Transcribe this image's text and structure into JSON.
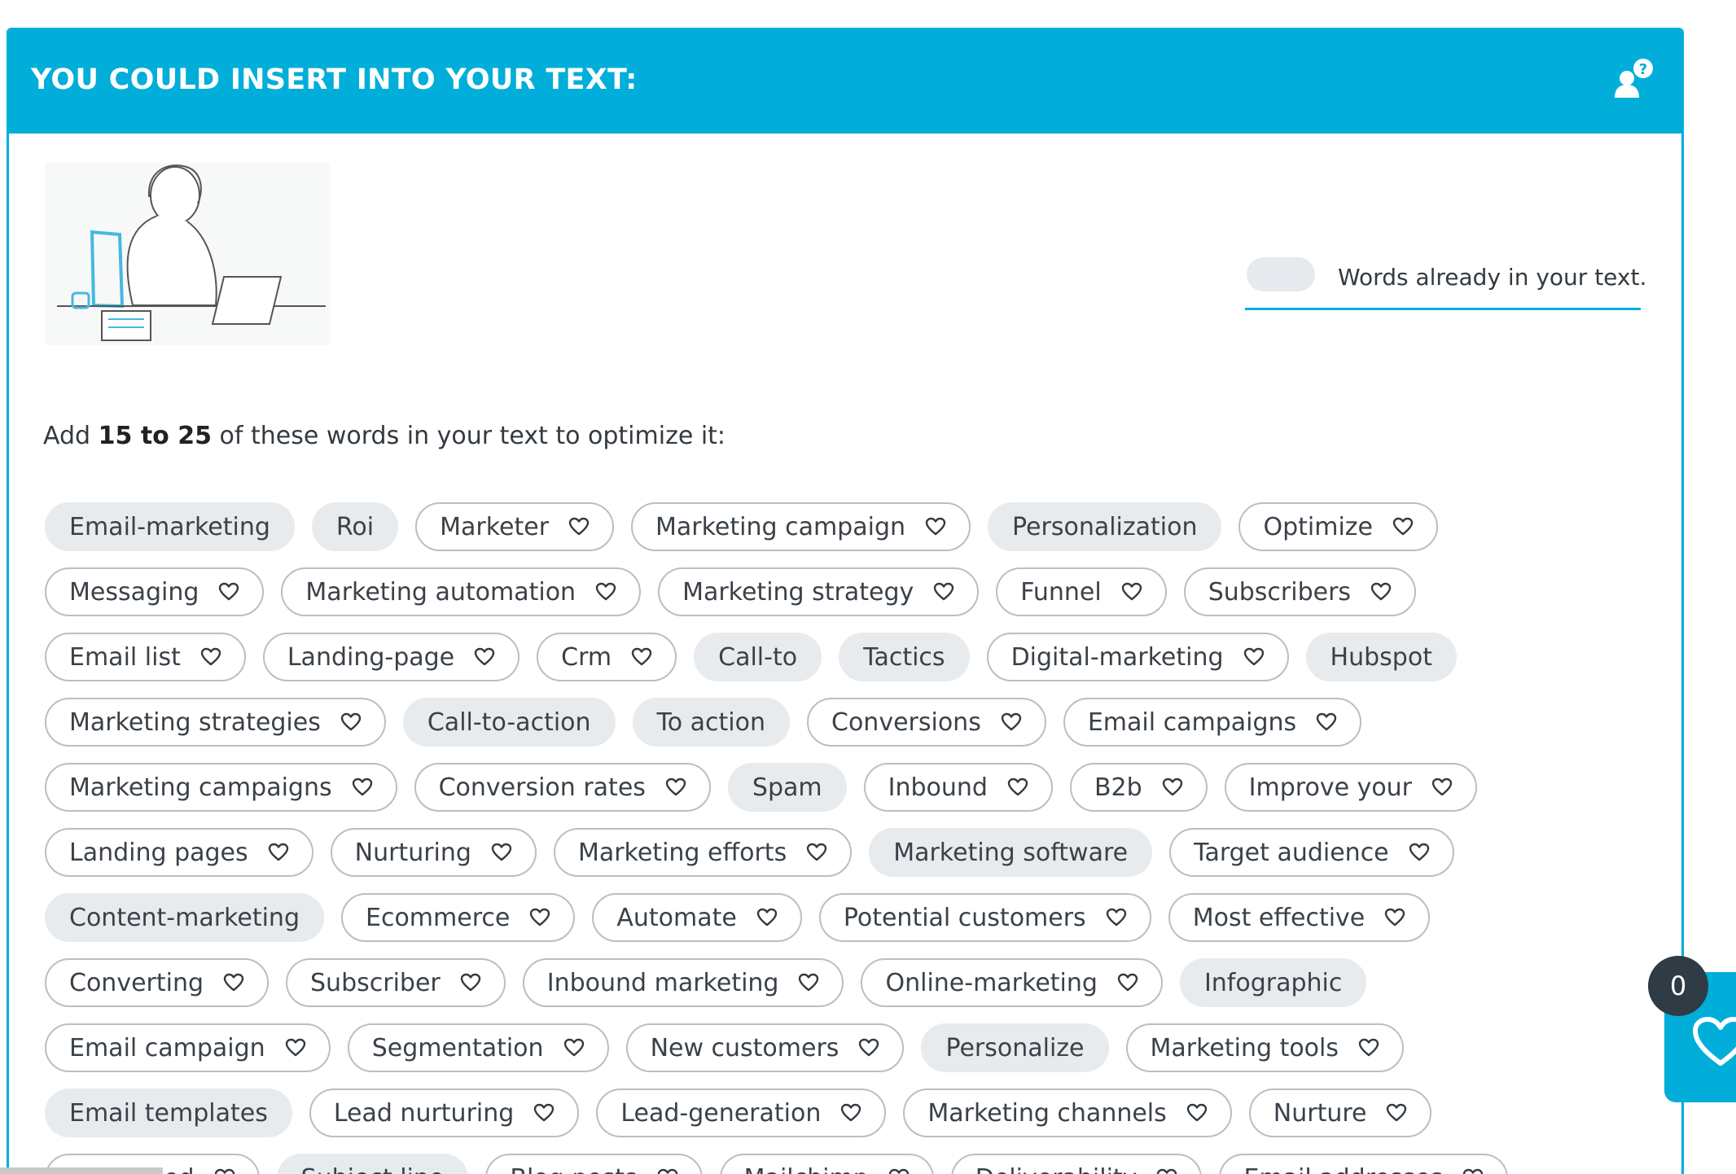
{
  "header": {
    "title": "YOU COULD INSERT INTO YOUR TEXT:",
    "help_icon": "user-question-icon"
  },
  "legend": {
    "label": "Words already in your text."
  },
  "instruction": {
    "prefix": "Add",
    "range": "15 to 25",
    "suffix": "of these words in your text to optimize it:"
  },
  "colors": {
    "accent": "#00aed9",
    "chip_done": "#e8ebee",
    "badge": "#2f3b45"
  },
  "keyword_rows": [
    [
      {
        "label": "Email-marketing",
        "in_text": true
      },
      {
        "label": "Roi",
        "in_text": true
      },
      {
        "label": "Marketer",
        "in_text": false
      },
      {
        "label": "Marketing campaign",
        "in_text": false
      },
      {
        "label": "Personalization",
        "in_text": true
      },
      {
        "label": "Optimize",
        "in_text": false
      }
    ],
    [
      {
        "label": "Messaging",
        "in_text": false
      },
      {
        "label": "Marketing automation",
        "in_text": false
      },
      {
        "label": "Marketing strategy",
        "in_text": false
      },
      {
        "label": "Funnel",
        "in_text": false
      },
      {
        "label": "Subscribers",
        "in_text": false
      }
    ],
    [
      {
        "label": "Email list",
        "in_text": false
      },
      {
        "label": "Landing-page",
        "in_text": false
      },
      {
        "label": "Crm",
        "in_text": false
      },
      {
        "label": "Call-to",
        "in_text": true
      },
      {
        "label": "Tactics",
        "in_text": true
      },
      {
        "label": "Digital-marketing",
        "in_text": false
      },
      {
        "label": "Hubspot",
        "in_text": true
      }
    ],
    [
      {
        "label": "Marketing strategies",
        "in_text": false
      },
      {
        "label": "Call-to-action",
        "in_text": true
      },
      {
        "label": "To action",
        "in_text": true
      },
      {
        "label": "Conversions",
        "in_text": false
      },
      {
        "label": "Email campaigns",
        "in_text": false
      }
    ],
    [
      {
        "label": "Marketing campaigns",
        "in_text": false
      },
      {
        "label": "Conversion rates",
        "in_text": false
      },
      {
        "label": "Spam",
        "in_text": true
      },
      {
        "label": "Inbound",
        "in_text": false
      },
      {
        "label": "B2b",
        "in_text": false
      },
      {
        "label": "Improve your",
        "in_text": false
      }
    ],
    [
      {
        "label": "Landing pages",
        "in_text": false
      },
      {
        "label": "Nurturing",
        "in_text": false
      },
      {
        "label": "Marketing efforts",
        "in_text": false
      },
      {
        "label": "Marketing software",
        "in_text": true
      },
      {
        "label": "Target audience",
        "in_text": false
      }
    ],
    [
      {
        "label": "Content-marketing",
        "in_text": true
      },
      {
        "label": "Ecommerce",
        "in_text": false
      },
      {
        "label": "Automate",
        "in_text": false
      },
      {
        "label": "Potential customers",
        "in_text": false
      },
      {
        "label": "Most effective",
        "in_text": false
      }
    ],
    [
      {
        "label": "Converting",
        "in_text": false
      },
      {
        "label": "Subscriber",
        "in_text": false
      },
      {
        "label": "Inbound marketing",
        "in_text": false
      },
      {
        "label": "Online-marketing",
        "in_text": false
      },
      {
        "label": "Infographic",
        "in_text": true
      }
    ],
    [
      {
        "label": "Email campaign",
        "in_text": false
      },
      {
        "label": "Segmentation",
        "in_text": false
      },
      {
        "label": "New customers",
        "in_text": false
      },
      {
        "label": "Personalize",
        "in_text": true
      },
      {
        "label": "Marketing tools",
        "in_text": false
      }
    ],
    [
      {
        "label": "Email templates",
        "in_text": true
      },
      {
        "label": "Lead nurturing",
        "in_text": false
      },
      {
        "label": "Lead-generation",
        "in_text": false
      },
      {
        "label": "Marketing channels",
        "in_text": false
      },
      {
        "label": "Nurture",
        "in_text": false
      }
    ],
    [
      {
        "label": "Optimized",
        "in_text": false
      },
      {
        "label": "Subject line",
        "in_text": true
      },
      {
        "label": "Blog posts",
        "in_text": false
      },
      {
        "label": "Mailchimp",
        "in_text": false
      },
      {
        "label": "Deliverability",
        "in_text": false
      },
      {
        "label": "Email addresses",
        "in_text": false
      }
    ]
  ],
  "favorites": {
    "count": "0",
    "icon": "heart-icon"
  }
}
